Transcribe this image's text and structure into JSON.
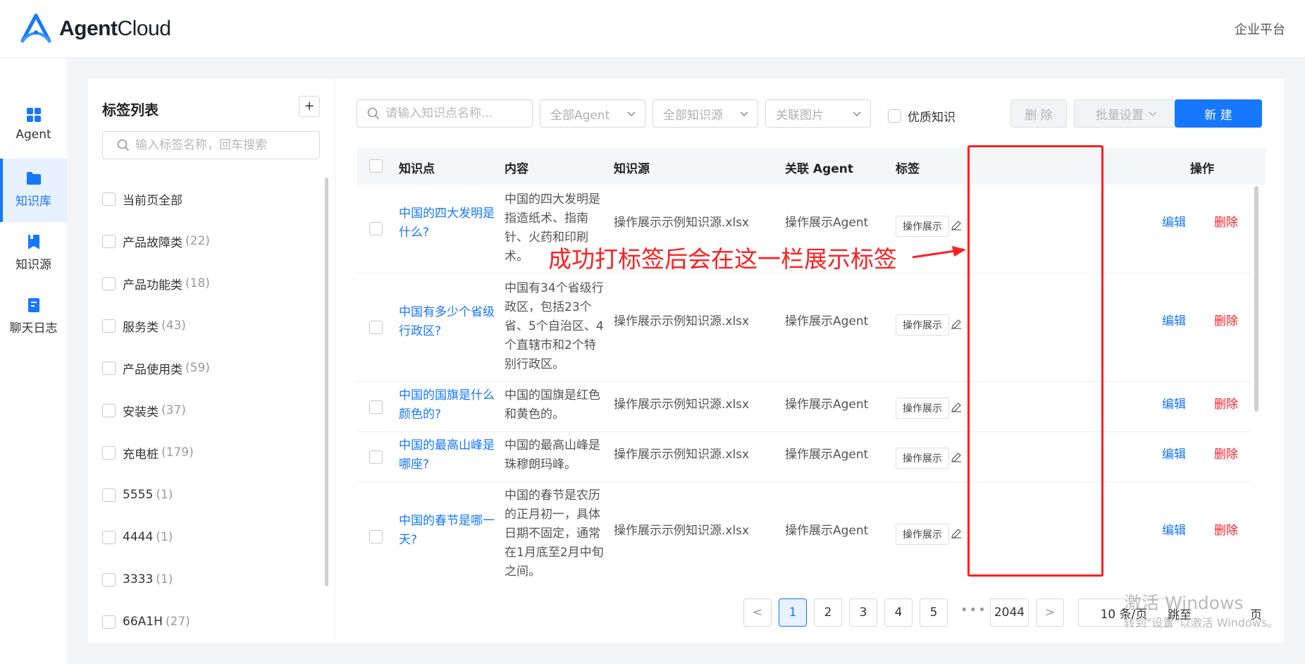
{
  "header": {
    "brand_bold": "Agent",
    "brand_light": "Cloud",
    "enterprise_link": "企业平台"
  },
  "nav": {
    "items": [
      {
        "label": "Agent",
        "icon": "dashboard-icon"
      },
      {
        "label": "知识库",
        "icon": "folder-icon",
        "active": true
      },
      {
        "label": "知识源",
        "icon": "bookmark-icon"
      },
      {
        "label": "聊天日志",
        "icon": "document-icon"
      }
    ]
  },
  "tag_panel": {
    "title": "标签列表",
    "add_label": "+",
    "search_placeholder": "输入标签名称，回车搜索",
    "items": [
      {
        "name": "当前页全部",
        "count": ""
      },
      {
        "name": "产品故障类",
        "count": "(22)"
      },
      {
        "name": "产品功能类",
        "count": "(18)"
      },
      {
        "name": "服务类",
        "count": "(43)"
      },
      {
        "name": "产品使用类",
        "count": "(59)"
      },
      {
        "name": "安装类",
        "count": "(37)"
      },
      {
        "name": "充电桩",
        "count": "(179)"
      },
      {
        "name": "5555",
        "count": "(1)"
      },
      {
        "name": "4444",
        "count": "(1)"
      },
      {
        "name": "3333",
        "count": "(1)"
      },
      {
        "name": "66A1H",
        "count": "(27)"
      }
    ]
  },
  "toolbar": {
    "search_placeholder": "请输入知识点名称...",
    "agent_filter": "全部Agent",
    "source_filter": "全部知识源",
    "image_filter": "关联图片",
    "quality_label": "优质知识",
    "delete_label": "删 除",
    "batch_label": "批量设置",
    "new_label": "新 建"
  },
  "table": {
    "headers": {
      "question": "知识点",
      "content": "内容",
      "source": "知识源",
      "agent": "关联 Agent",
      "tags": "标签",
      "actions": "操作"
    },
    "rows": [
      {
        "question": [
          "中国的四大发明是",
          "什么?"
        ],
        "content": [
          "中国的四大发明是",
          "指造纸术、指南",
          "针、火药和印刷",
          "术。"
        ],
        "source": "操作展示示例知识源.xlsx",
        "agent": "操作展示Agent",
        "tag": "操作展示",
        "edit": "编辑",
        "delete": "删除"
      },
      {
        "question": [
          "中国有多少个省级",
          "行政区?"
        ],
        "content": [
          "中国有34个省级行",
          "政区，包括23个",
          "省、5个自治区、4",
          "个直辖市和2个特",
          "别行政区。"
        ],
        "source": "操作展示示例知识源.xlsx",
        "agent": "操作展示Agent",
        "tag": "操作展示",
        "edit": "编辑",
        "delete": "删除"
      },
      {
        "question": [
          "中国的国旗是什么",
          "颜色的?"
        ],
        "content": [
          "中国的国旗是红色",
          "和黄色的。"
        ],
        "source": "操作展示示例知识源.xlsx",
        "agent": "操作展示Agent",
        "tag": "操作展示",
        "edit": "编辑",
        "delete": "删除"
      },
      {
        "question": [
          "中国的最高山峰是",
          "哪座?"
        ],
        "content": [
          "中国的最高山峰是",
          "珠穆朗玛峰。"
        ],
        "source": "操作展示示例知识源.xlsx",
        "agent": "操作展示Agent",
        "tag": "操作展示",
        "edit": "编辑",
        "delete": "删除"
      },
      {
        "question": [
          "中国的春节是哪一",
          "天?"
        ],
        "content": [
          "中国的春节是农历",
          "的正月初一，具体",
          "日期不固定，通常",
          "在1月底至2月中旬",
          "之间。"
        ],
        "source": "操作展示示例知识源.xlsx",
        "agent": "操作展示Agent",
        "tag": "操作展示",
        "edit": "编辑",
        "delete": "删除"
      }
    ]
  },
  "annotation": {
    "text": "成功打标签后会在这一栏展示标签",
    "color": "#ff1f1f"
  },
  "pagination": {
    "prev": "<",
    "pages": [
      "1",
      "2",
      "3",
      "4",
      "5"
    ],
    "current": "1",
    "ellipsis": "•••",
    "last": "2044",
    "next": ">",
    "page_size": "10 条/页",
    "jump_label": "跳至",
    "page_suffix": "页"
  },
  "watermark": {
    "line1": "激活 Windows",
    "line2": "转到\"设置\"以激活 Windows。"
  },
  "colors": {
    "primary": "#1677ff",
    "danger": "#f5222d",
    "annotation": "#ff1f1f"
  }
}
